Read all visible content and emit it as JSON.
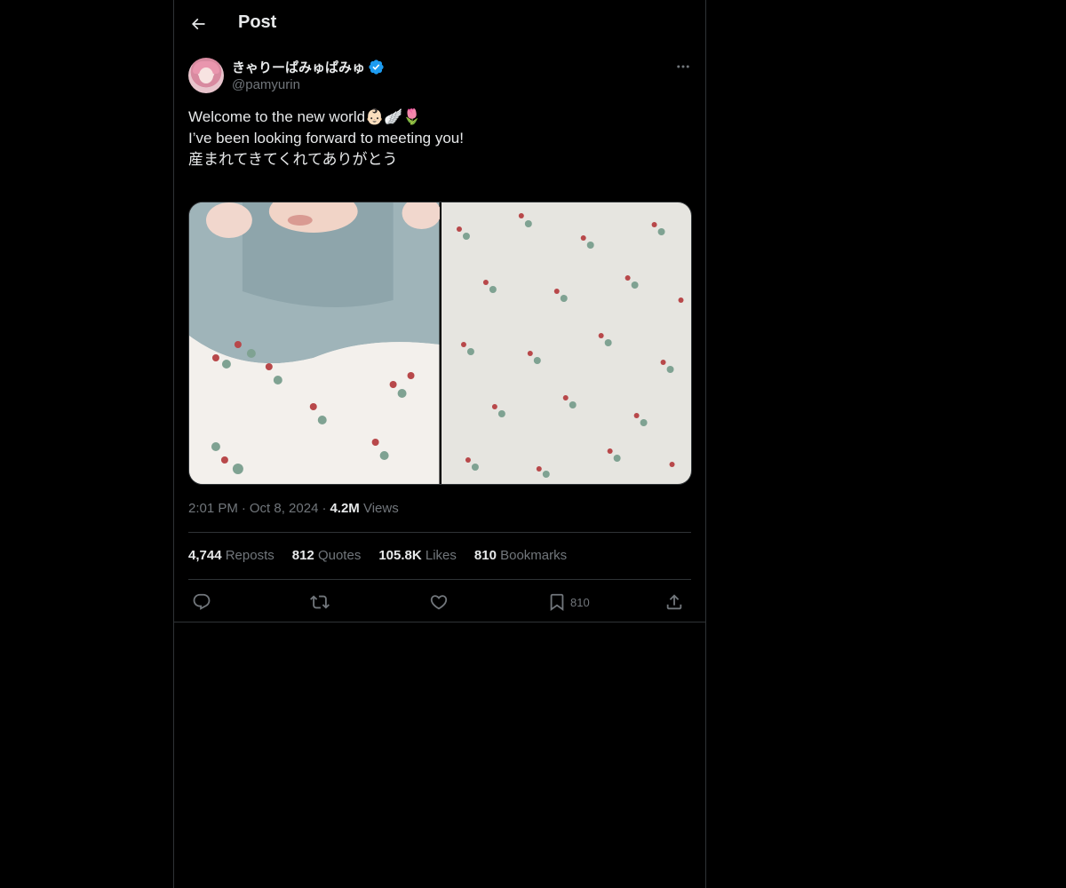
{
  "header": {
    "title": "Post",
    "back_icon": "arrow-left-icon"
  },
  "author": {
    "display_name": "きゃりーぱみゅぱみゅ",
    "handle": "@pamyurin",
    "verified": true,
    "verified_color": "#1d9bf0",
    "more_icon": "more-horizontal-icon"
  },
  "post": {
    "text_lines": [
      "Welcome to the new world👶🏻🪽🌷",
      "I’ve been looking forward to meeting you!",
      "",
      "産まれてきてくれてありがとう"
    ],
    "media": [
      {
        "alt": "baby in blue knit cardigan under floral blanket"
      },
      {
        "alt": "white muslin blanket with small red and green floral print"
      }
    ],
    "time": "2:01 PM",
    "date": "Oct 8, 2024",
    "views_count": "4.2M",
    "views_label": "Views",
    "separator": "·"
  },
  "stats": {
    "reposts": {
      "count": "4,744",
      "label": "Reposts"
    },
    "quotes": {
      "count": "812",
      "label": "Quotes"
    },
    "likes": {
      "count": "105.8K",
      "label": "Likes"
    },
    "bookmarks": {
      "count": "810",
      "label": "Bookmarks"
    }
  },
  "actions": {
    "reply_icon": "reply-icon",
    "repost_icon": "repost-icon",
    "like_icon": "heart-icon",
    "bookmark_icon": "bookmark-icon",
    "bookmark_count": "810",
    "share_icon": "share-icon"
  },
  "colors": {
    "background": "#000000",
    "text": "#e7e9ea",
    "secondary": "#71767b",
    "border": "#2f3336",
    "accent": "#1d9bf0"
  }
}
